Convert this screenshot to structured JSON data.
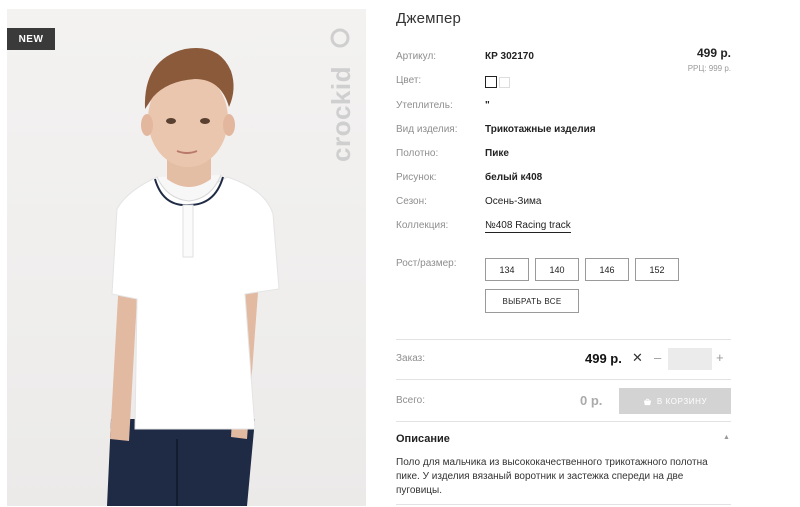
{
  "badge": "NEW",
  "brand": "crockid",
  "product": {
    "title": "Джемпер",
    "price": "499 р.",
    "rrp": "РРЦ: 999 р."
  },
  "attributes": [
    {
      "label": "Артикул:",
      "value": "КР 302170"
    },
    {
      "label": "Цвет:",
      "value": ""
    },
    {
      "label": "Утеплитель:",
      "value": "\""
    },
    {
      "label": "Вид изделия:",
      "value": "Трикотажные изделия"
    },
    {
      "label": "Полотно:",
      "value": "Пике"
    },
    {
      "label": "Рисунок:",
      "value": "белый к408"
    },
    {
      "label": "Сезон:",
      "value": "Осень-Зима"
    },
    {
      "label": "Коллекция:",
      "value": "№408 Racing track"
    }
  ],
  "sizes": {
    "label": "Рост/размер:",
    "options": [
      "134",
      "140",
      "146",
      "152"
    ],
    "select_all": "ВЫБРАТЬ ВСЕ"
  },
  "order": {
    "label": "Заказ:",
    "price": "499 р.",
    "times": "✕",
    "minus": "–",
    "plus": "+",
    "quantity": ""
  },
  "total": {
    "label": "Всего:",
    "value": "0 р.",
    "cart_button": "В КОРЗИНУ",
    "cart_icon": "basket-icon"
  },
  "description": {
    "title": "Описание",
    "toggle_icon": "caret-up-icon",
    "text": "Поло для мальчика из высококачественного трикотажного полотна пике. У изделия вязаный воротник и застежка спереди на две пуговицы."
  },
  "colors": {
    "badge_bg": "#3a3a3a",
    "cart_button_bg": "#d3d3d3",
    "qty_bg": "#ebebeb"
  }
}
